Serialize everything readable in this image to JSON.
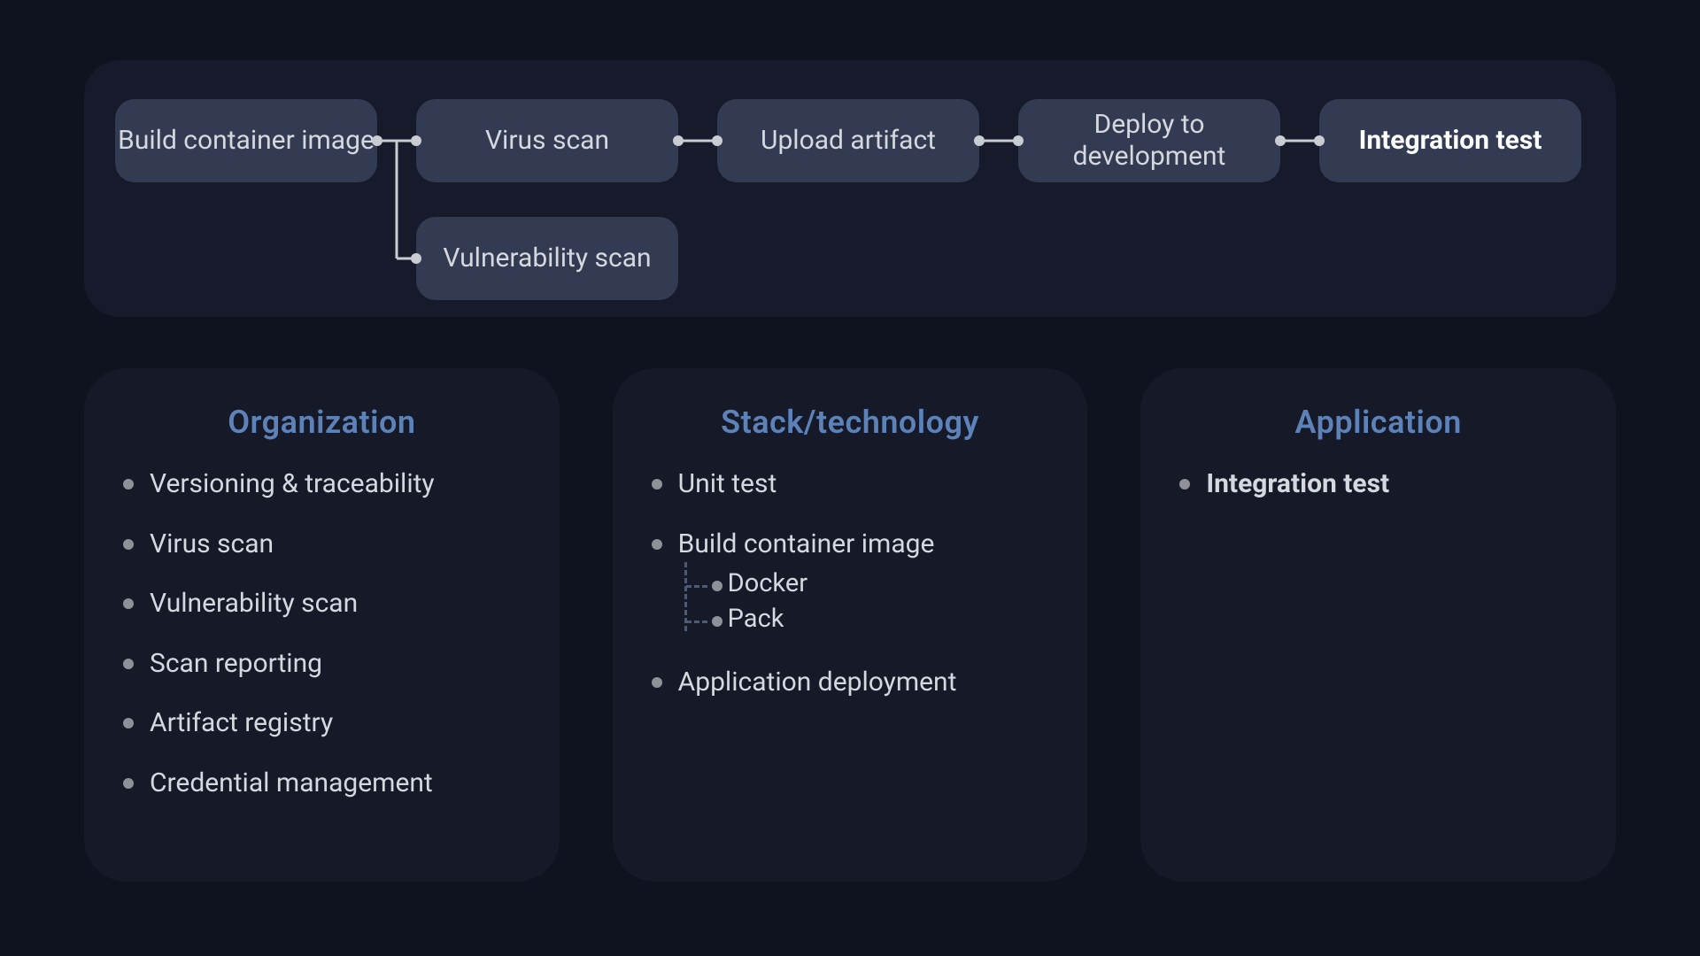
{
  "pipeline": {
    "steps": [
      {
        "label": "Build container image",
        "bold": false
      },
      {
        "label": "Virus scan",
        "bold": false
      },
      {
        "label": "Upload artifact",
        "bold": false
      },
      {
        "label": "Deploy to development",
        "bold": false
      },
      {
        "label": "Integration test",
        "bold": true
      },
      {
        "label": "Vulnerability scan",
        "bold": false
      }
    ]
  },
  "panels": {
    "org": {
      "title": "Organization",
      "items": [
        "Versioning & traceability",
        "Virus scan",
        "Vulnerability scan",
        "Scan reporting",
        "Artifact registry",
        "Credential management"
      ]
    },
    "stack": {
      "title": "Stack/technology",
      "items": [
        "Unit test",
        "Build container image",
        "Application deployment"
      ],
      "subitems": [
        "Docker",
        "Pack"
      ]
    },
    "app": {
      "title": "Application",
      "items": [
        {
          "label": "Integration test",
          "bold": true
        }
      ]
    }
  }
}
